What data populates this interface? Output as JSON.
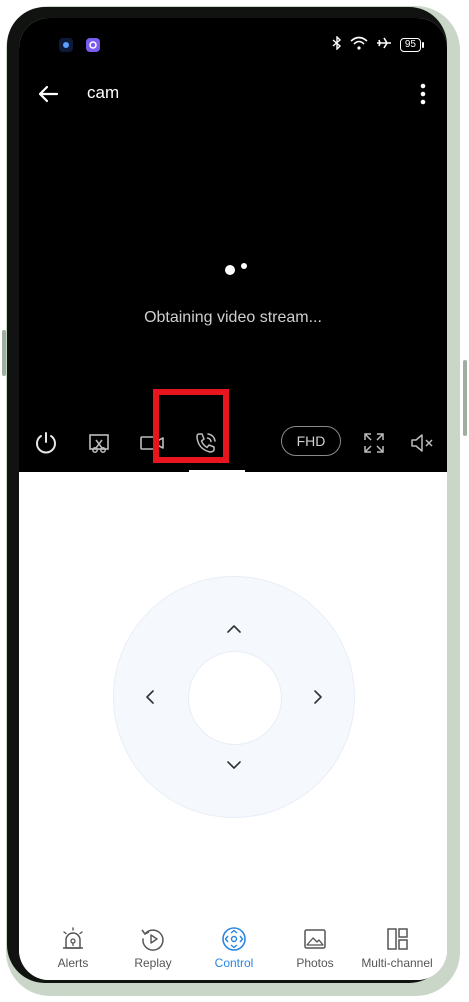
{
  "status_bar": {
    "battery": "95"
  },
  "header": {
    "title": "cam"
  },
  "video": {
    "loading_text": "Obtaining video stream..."
  },
  "controls": {
    "quality_label": "FHD"
  },
  "nav": {
    "items": [
      {
        "label": "Alerts"
      },
      {
        "label": "Replay"
      },
      {
        "label": "Control"
      },
      {
        "label": "Photos"
      },
      {
        "label": "Multi-channel"
      }
    ],
    "active_color": "#2a86e0"
  },
  "highlight_color": "#e8141e"
}
